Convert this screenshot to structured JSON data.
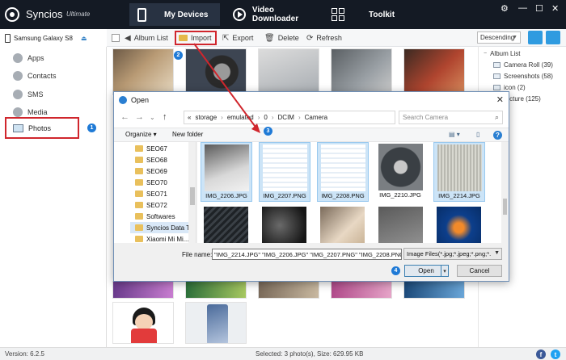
{
  "app": {
    "name": "Syncios",
    "edition": "Ultimate"
  },
  "nav": {
    "my_devices": "My Devices",
    "video_downloader": "Video Downloader",
    "toolkit": "Toolkit"
  },
  "device": {
    "name": "Samsung Galaxy S8"
  },
  "sidebar": {
    "apps": "Apps",
    "contacts": "Contacts",
    "sms": "SMS",
    "media": "Media",
    "photos": "Photos"
  },
  "toolbar": {
    "album_list": "Album List",
    "import": "Import",
    "export": "Export",
    "delete": "Delete",
    "refresh": "Refresh",
    "sort": "Descending"
  },
  "albums": {
    "title": "Album List",
    "items": [
      "Camera Roll (39)",
      "Screenshots (58)",
      "icon (2)",
      "Picture (125)"
    ]
  },
  "steps": {
    "s1": "1",
    "s2": "2",
    "s3": "3",
    "s4": "4"
  },
  "dialog": {
    "title": "Open",
    "path": [
      "«",
      "storage",
      "emulated",
      "0",
      "DCIM",
      "Camera"
    ],
    "search_placeholder": "Search Camera",
    "organize": "Organize ▾",
    "new_folder": "New folder",
    "help": "?",
    "folders": [
      "SEO67",
      "SEO68",
      "SEO69",
      "SEO70",
      "SEO71",
      "SEO72",
      "Softwares",
      "Syncios Data Tr",
      "Xiaomi Mi Mi..."
    ],
    "files": [
      {
        "name": "IMG_2206.JPG",
        "selected": true
      },
      {
        "name": "IMG_2207.PNG",
        "selected": true
      },
      {
        "name": "IMG_2208.PNG",
        "selected": true
      },
      {
        "name": "IMG_2210.JPG",
        "selected": false
      },
      {
        "name": "IMG_2214.JPG",
        "selected": true
      }
    ],
    "file_name_label": "File name:",
    "file_name_value": "\"IMG_2214.JPG\" \"IMG_2206.JPG\" \"IMG_2207.PNG\" \"IMG_2208.PNG\"",
    "file_type": "Image Files(*.jpg;*.jpeg;*.png;*.",
    "open": "Open",
    "cancel": "Cancel"
  },
  "status": {
    "version": "Version: 6.2.5",
    "selected": "Selected: 3 photo(s), Size: 629.95 KB"
  },
  "colors": {
    "titlebar": "#141a24",
    "highlight_red": "#d0262d",
    "step_blue": "#1f7ad6",
    "selection_blue": "#cce4f7",
    "facebook": "#3b5998",
    "twitter": "#1da1f2"
  }
}
